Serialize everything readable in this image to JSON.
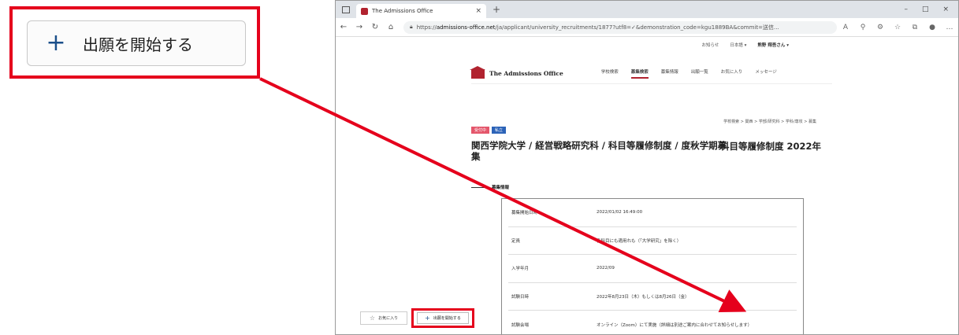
{
  "callout": {
    "plus_icon": "plus-icon",
    "label": "出願を開始する"
  },
  "browser": {
    "tab_title": "The Admissions Office",
    "tab_close": "×",
    "new_tab": "+",
    "window_controls": [
      "–",
      "□",
      "×"
    ],
    "url_scheme": "https://",
    "url_host": "admissions-office.net",
    "url_rest": "/ja/applicant/university_recruitments/1877?utf8=✓&demonstration_code=kgu1889BA&commit=送信..."
  },
  "page": {
    "top_menu": [
      "お知らせ",
      "日本語 ▾",
      "熊野 翔吾さん ▾"
    ],
    "logo_text": "The Admissions Office",
    "nav": [
      "学校検索",
      "募集検索",
      "募集情報",
      "出願一覧",
      "お気に入り",
      "メッセージ"
    ],
    "nav_active_index": 1,
    "breadcrumb": "学校検索 > 関西 > 学部/研究科 > 学科/専攻 > 募集",
    "badges": [
      "受付中",
      "私立"
    ],
    "title_main": "関西学院大学 / 経営戦略研究科 / 科目等履修制度 / 度秋学期募集",
    "title_side": "科目等履修制度 2022年",
    "section_heading": "募集情報",
    "info_rows": [
      {
        "label": "募集開始日時",
        "value": "2022/01/02 16:49:00"
      },
      {
        "label": "定員",
        "value": "各科目にも適用れも（「大学研究」を除く）"
      },
      {
        "label": "入学年月",
        "value": "2022/09"
      },
      {
        "label": "試験日時",
        "value": "2022年8月23日（木）もしくは8月26日（金）"
      },
      {
        "label": "試験会場",
        "value": "オンライン（Zoom）にて実施（詳細は別途ご案内に合わせてお知らせします）"
      }
    ],
    "favorite_label": "お気に入り",
    "apply_label": "出願を開始する"
  },
  "colors": {
    "highlight": "#e5001c",
    "brand": "#b1232f",
    "accent": "#1b4f8a"
  }
}
